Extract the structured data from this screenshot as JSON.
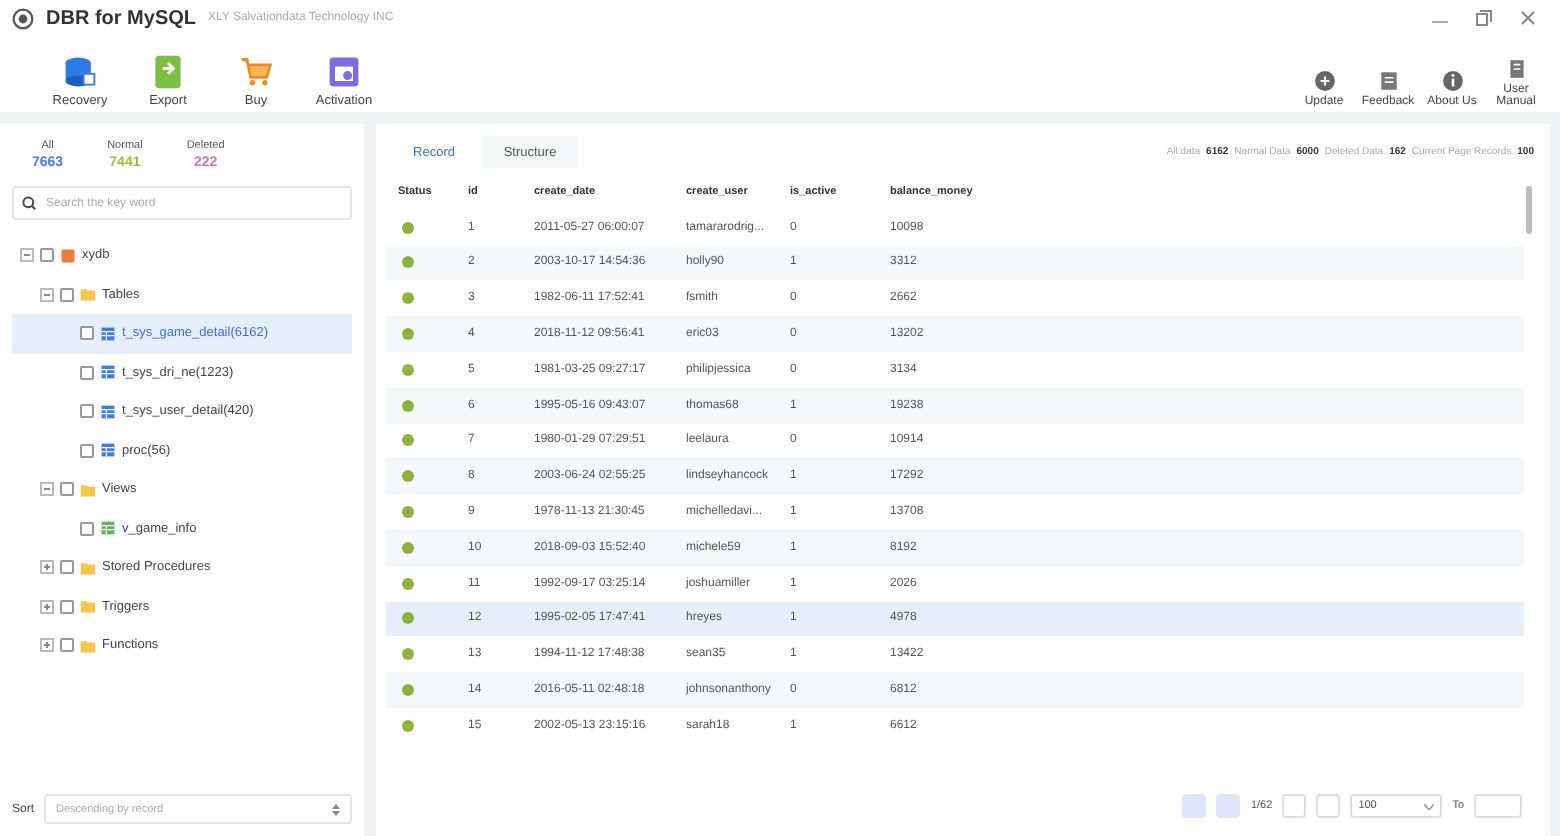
{
  "app": {
    "title": "DBR for MySQL",
    "subtitle": "XLY Salvationdata Technology INC"
  },
  "toolbar": [
    {
      "label": "Recovery",
      "kind": "recovery"
    },
    {
      "label": "Export",
      "kind": "export"
    },
    {
      "label": "Buy",
      "kind": "buy"
    },
    {
      "label": "Activation",
      "kind": "activation"
    }
  ],
  "help_toolbar": [
    {
      "label": "Update",
      "kind": "update"
    },
    {
      "label": "Feedback",
      "kind": "feedback"
    },
    {
      "label": "About Us",
      "kind": "about"
    },
    {
      "label": "User Manual",
      "kind": "manual"
    }
  ],
  "counters": [
    {
      "label": "All",
      "value": "7663",
      "color": "#4a7ee8"
    },
    {
      "label": "Normal",
      "value": "7441",
      "color": "#a8b83a"
    },
    {
      "label": "Deleted",
      "value": "222",
      "color": "#d070c8"
    }
  ],
  "search": {
    "placeholder": "Search the key word"
  },
  "tree": [
    {
      "label": "xydb",
      "kind": "database",
      "expanded": true,
      "selected": false,
      "children": [
        {
          "label": "Tables",
          "kind": "folder",
          "expanded": true,
          "selected": false,
          "children": [
            {
              "label": "t_sys_game_detail(6162)",
              "kind": "table",
              "selected": true
            },
            {
              "label": "t_sys_dri_ne(1223)",
              "kind": "table",
              "selected": false
            },
            {
              "label": "t_sys_user_detail(420)",
              "kind": "table",
              "selected": false
            },
            {
              "label": "proc(56)",
              "kind": "table",
              "selected": false
            }
          ]
        },
        {
          "label": "Views",
          "kind": "folder",
          "expanded": true,
          "selected": false,
          "children": [
            {
              "label": "v_game_info",
              "kind": "view",
              "selected": false
            }
          ]
        },
        {
          "label": "Stored Procedures",
          "kind": "folder",
          "expanded": false,
          "selected": false
        },
        {
          "label": "Triggers",
          "kind": "folder",
          "expanded": false,
          "selected": false
        },
        {
          "label": "Functions",
          "kind": "folder",
          "expanded": false,
          "selected": false
        }
      ]
    }
  ],
  "sort": {
    "label": "Sort",
    "placeholder": "Descending by record"
  },
  "tabs": [
    {
      "label": "Record",
      "selected": true
    },
    {
      "label": "Structure",
      "selected": false
    }
  ],
  "stats": [
    {
      "label": "All data",
      "value": "6162"
    },
    {
      "label": "Normal Data",
      "value": "6000"
    },
    {
      "label": "Deleted Data",
      "value": "162"
    },
    {
      "label": "Current Page Records",
      "value": "100"
    }
  ],
  "table": {
    "status_column": "Status",
    "columns": [
      "id",
      "create_date",
      "create_user",
      "is_active",
      "balance_money"
    ],
    "rows": [
      {
        "selected": false,
        "cells": [
          "1",
          "2011-05-27 06:00:07",
          "tamararodrig...",
          "0",
          "10098"
        ]
      },
      {
        "selected": false,
        "cells": [
          "2",
          "2003-10-17 14:54:36",
          "holly90",
          "1",
          "3312"
        ]
      },
      {
        "selected": false,
        "cells": [
          "3",
          "1982-06-11 17:52:41",
          "fsmith",
          "0",
          "2662"
        ]
      },
      {
        "selected": false,
        "cells": [
          "4",
          "2018-11-12 09:56:41",
          "eric03",
          "0",
          "13202"
        ]
      },
      {
        "selected": false,
        "cells": [
          "5",
          "1981-03-25 09:27:17",
          "philipjessica",
          "0",
          "3134"
        ]
      },
      {
        "selected": false,
        "cells": [
          "6",
          "1995-05-16 09:43:07",
          "thomas68",
          "1",
          "19238"
        ]
      },
      {
        "selected": false,
        "cells": [
          "7",
          "1980-01-29 07:29:51",
          "leelaura",
          "0",
          "10914"
        ]
      },
      {
        "selected": false,
        "cells": [
          "8",
          "2003-06-24 02:55:25",
          "lindseyhancock",
          "1",
          "17292"
        ]
      },
      {
        "selected": false,
        "cells": [
          "9",
          "1978-11-13 21:30:45",
          "michelledavi...",
          "1",
          "13708"
        ]
      },
      {
        "selected": false,
        "cells": [
          "10",
          "2018-09-03 15:52:40",
          "michele59",
          "1",
          "8192"
        ]
      },
      {
        "selected": false,
        "cells": [
          "11",
          "1992-09-17 03:25:14",
          "joshuamiller",
          "1",
          "2026"
        ]
      },
      {
        "selected": true,
        "cells": [
          "12",
          "1995-02-05 17:47:41",
          "hreyes",
          "1",
          "4978"
        ]
      },
      {
        "selected": false,
        "cells": [
          "13",
          "1994-11-12 17:48:38",
          "sean35",
          "1",
          "13422"
        ]
      },
      {
        "selected": false,
        "cells": [
          "14",
          "2016-05-11 02:48:18",
          "johnsonanthony",
          "0",
          "6812"
        ]
      },
      {
        "selected": false,
        "cells": [
          "15",
          "2002-05-13 23:15:16",
          "sarah18",
          "1",
          "6612"
        ]
      }
    ]
  },
  "pagination": {
    "page": "1/62",
    "page_size": "100",
    "goto_label": "To"
  }
}
